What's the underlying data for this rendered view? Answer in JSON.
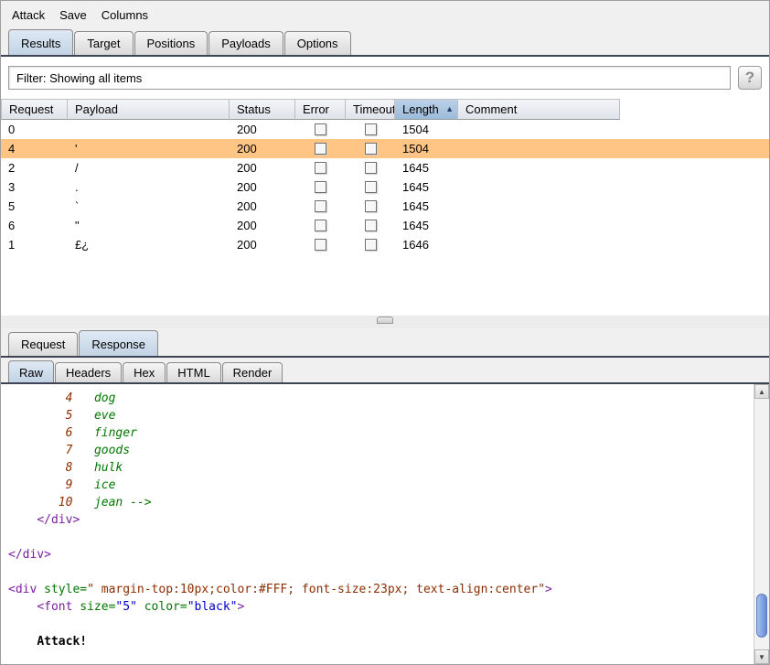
{
  "colors": {
    "selection-orange": "#ffc584",
    "sorted-header-top": "#bad1e8",
    "sorted-header-bottom": "#9cbcda",
    "tab-selected-top": "#dfe9f4",
    "tab-selected-bottom": "#c2d3e4",
    "accent-line": "#3c4456",
    "syntax-num": "#8b2e00",
    "syntax-word": "#007800",
    "syntax-tag": "#7c1fa2",
    "syntax-attr": "#007800",
    "syntax-str": "#8b2e00",
    "syntax-val": "#0000cc",
    "scroll-thumb": "#7fa0e2"
  },
  "menu": {
    "items": [
      "Attack",
      "Save",
      "Columns"
    ]
  },
  "main_tabs": {
    "labels": [
      "Results",
      "Target",
      "Positions",
      "Payloads",
      "Options"
    ],
    "selected_index": 0
  },
  "filter": {
    "text": "Filter: Showing all items",
    "help_label": "?"
  },
  "results_table": {
    "columns": [
      "Request",
      "Payload",
      "Status",
      "Error",
      "Timeout",
      "Length",
      "Comment"
    ],
    "sort": {
      "column": "Length",
      "direction": "asc",
      "icon": "▲"
    },
    "rows": [
      {
        "request": "0",
        "payload": "",
        "status": "200",
        "error": false,
        "timeout": false,
        "length": "1504",
        "comment": "",
        "selected": false
      },
      {
        "request": "4",
        "payload": "'",
        "status": "200",
        "error": false,
        "timeout": false,
        "length": "1504",
        "comment": "",
        "selected": true
      },
      {
        "request": "2",
        "payload": "/",
        "status": "200",
        "error": false,
        "timeout": false,
        "length": "1645",
        "comment": "",
        "selected": false
      },
      {
        "request": "3",
        "payload": ".",
        "status": "200",
        "error": false,
        "timeout": false,
        "length": "1645",
        "comment": "",
        "selected": false
      },
      {
        "request": "5",
        "payload": "`",
        "status": "200",
        "error": false,
        "timeout": false,
        "length": "1645",
        "comment": "",
        "selected": false
      },
      {
        "request": "6",
        "payload": "\"",
        "status": "200",
        "error": false,
        "timeout": false,
        "length": "1645",
        "comment": "",
        "selected": false
      },
      {
        "request": "1",
        "payload": "£¿",
        "status": "200",
        "error": false,
        "timeout": false,
        "length": "1646",
        "comment": "",
        "selected": false
      }
    ]
  },
  "message_tabs": {
    "labels": [
      "Request",
      "Response"
    ],
    "selected_index": 1
  },
  "view_tabs": {
    "labels": [
      "Raw",
      "Headers",
      "Hex",
      "HTML",
      "Render"
    ],
    "selected_index": 0
  },
  "response": {
    "lines": [
      {
        "segments": [
          {
            "text": "        4",
            "style": "num"
          },
          {
            "text": "   ",
            "style": "plain"
          },
          {
            "text": "dog",
            "style": "word"
          }
        ]
      },
      {
        "segments": [
          {
            "text": "        5",
            "style": "num"
          },
          {
            "text": "   ",
            "style": "plain"
          },
          {
            "text": "eve",
            "style": "word"
          }
        ]
      },
      {
        "segments": [
          {
            "text": "        6",
            "style": "num"
          },
          {
            "text": "   ",
            "style": "plain"
          },
          {
            "text": "finger",
            "style": "word"
          }
        ]
      },
      {
        "segments": [
          {
            "text": "        7",
            "style": "num"
          },
          {
            "text": "   ",
            "style": "plain"
          },
          {
            "text": "goods",
            "style": "word"
          }
        ]
      },
      {
        "segments": [
          {
            "text": "        8",
            "style": "num"
          },
          {
            "text": "   ",
            "style": "plain"
          },
          {
            "text": "hulk",
            "style": "word"
          }
        ]
      },
      {
        "segments": [
          {
            "text": "        9",
            "style": "num"
          },
          {
            "text": "   ",
            "style": "plain"
          },
          {
            "text": "ice",
            "style": "word"
          }
        ]
      },
      {
        "segments": [
          {
            "text": "       10",
            "style": "num"
          },
          {
            "text": "   ",
            "style": "plain"
          },
          {
            "text": "jean -->",
            "style": "word"
          }
        ]
      },
      {
        "segments": [
          {
            "text": "    ",
            "style": "plain"
          },
          {
            "text": "</div>",
            "style": "tag"
          }
        ]
      },
      {
        "segments": []
      },
      {
        "segments": [
          {
            "text": "</div>",
            "style": "tag"
          }
        ]
      },
      {
        "segments": []
      },
      {
        "segments": [
          {
            "text": "<div ",
            "style": "tag"
          },
          {
            "text": "style=",
            "style": "attr"
          },
          {
            "text": "\" margin-top:10px;color:#FFF; font-size:23px; text-align:center\"",
            "style": "str"
          },
          {
            "text": ">",
            "style": "tag"
          }
        ]
      },
      {
        "segments": [
          {
            "text": "    ",
            "style": "plain"
          },
          {
            "text": "<font ",
            "style": "tag"
          },
          {
            "text": "size=",
            "style": "attr"
          },
          {
            "text": "\"5\"",
            "style": "val"
          },
          {
            "text": " ",
            "style": "plain"
          },
          {
            "text": "color=",
            "style": "attr"
          },
          {
            "text": "\"black\"",
            "style": "val"
          },
          {
            "text": ">",
            "style": "tag"
          }
        ]
      },
      {
        "segments": []
      },
      {
        "segments": [
          {
            "text": "    ",
            "style": "plain"
          },
          {
            "text": "Attack!",
            "style": "bold"
          }
        ]
      }
    ]
  },
  "scrollbar": {
    "up_icon": "▲",
    "down_icon": "▼"
  }
}
